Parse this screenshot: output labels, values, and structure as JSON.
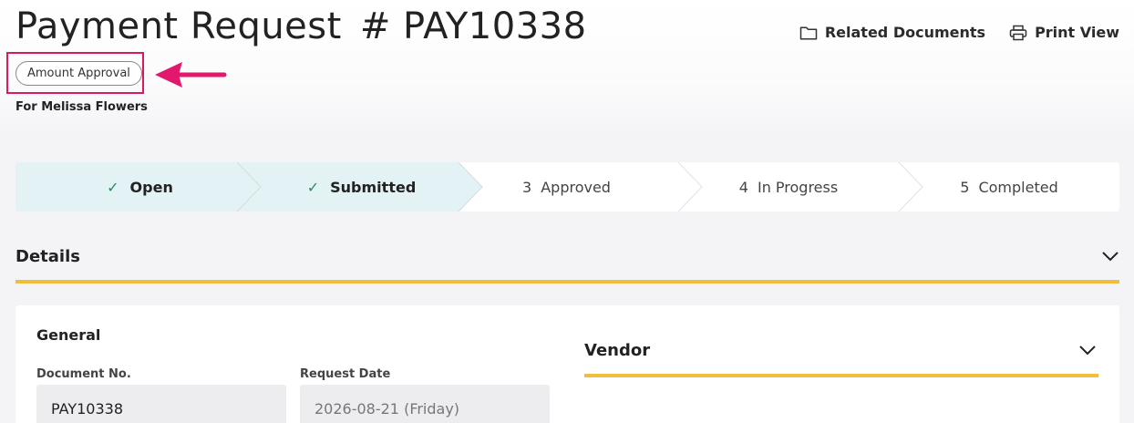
{
  "header": {
    "title": "Payment Request",
    "number": "# PAY10338",
    "actions": [
      {
        "label": "Related Documents",
        "icon": "folder-icon"
      },
      {
        "label": "Print View",
        "icon": "printer-icon"
      }
    ],
    "badge": "Amount Approval",
    "subtitle": "For Melissa Flowers"
  },
  "stepper": {
    "steps": [
      {
        "marker": "✓",
        "label": "Open",
        "status": "done"
      },
      {
        "marker": "✓",
        "label": "Submitted",
        "status": "done"
      },
      {
        "marker": "3",
        "label": "Approved",
        "status": "pending"
      },
      {
        "marker": "4",
        "label": "In Progress",
        "status": "pending"
      },
      {
        "marker": "5",
        "label": "Completed",
        "status": "pending"
      }
    ]
  },
  "details": {
    "title": "Details",
    "general": {
      "title": "General",
      "fields": [
        {
          "label": "Document No.",
          "value": "PAY10338"
        },
        {
          "label": "Request Date",
          "value": "2026-08-21 (Friday)"
        }
      ]
    },
    "vendor": {
      "title": "Vendor"
    }
  },
  "colors": {
    "accent_yellow": "#f2bd3c",
    "highlight_pink": "#d81b60",
    "step_done_bg": "#e3f2f4",
    "check_green": "#2c8a6a",
    "page_bg": "#f4f3f6"
  }
}
